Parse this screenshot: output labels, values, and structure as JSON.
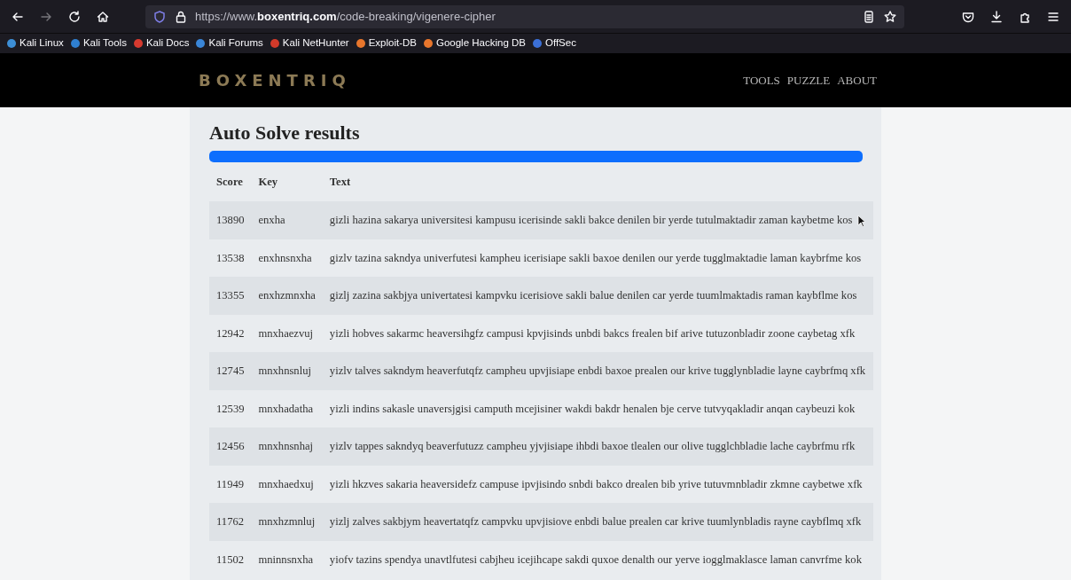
{
  "browser": {
    "url": "https://www.**boxentriq.com**/code-breaking/vigenere-cipher",
    "back_disabled": false,
    "forward_disabled": true
  },
  "bookmarks": [
    {
      "label": "Kali Linux",
      "color": "#3d8fd6"
    },
    {
      "label": "Kali Tools",
      "color": "#2f7fd0"
    },
    {
      "label": "Kali Docs",
      "color": "#d63a2f"
    },
    {
      "label": "Kali Forums",
      "color": "#3a86d8"
    },
    {
      "label": "Kali NetHunter",
      "color": "#d23a2a"
    },
    {
      "label": "Exploit-DB",
      "color": "#e8762c"
    },
    {
      "label": "Google Hacking DB",
      "color": "#e8762c"
    },
    {
      "label": "OffSec",
      "color": "#3b6fd6"
    }
  ],
  "site": {
    "logo": "BOXENTRIQ",
    "nav": [
      "TOOLS",
      "PUZZLE",
      "ABOUT"
    ]
  },
  "results": {
    "title": "Auto Solve results",
    "progress": {
      "level": 1
    },
    "columns": [
      "Score",
      "Key",
      "Text"
    ],
    "rows": [
      [
        "13890",
        "enxha",
        "gizli hazina sakarya universitesi kampusu icerisinde sakli bakce denilen bir yerde tutulmaktadir zaman kaybetme kos"
      ],
      [
        "13538",
        "enxhnsnxha",
        "gizlv tazina sakndya univerfutesi kampheu icerisiape sakli baxoe denilen our yerde tugglmaktadie laman kaybrfme kos"
      ],
      [
        "13355",
        "enxhzmnxha",
        "gizlj zazina sakbjya univertatesi kampvku icerisiove sakli balue denilen car yerde tuumlmaktadis raman kaybflme kos"
      ],
      [
        "12942",
        "mnxhaezvuj",
        "yizli hobves sakarmc heaversihgfz campusi kpvjisinds unbdi bakcs frealen bif arive tutuzonbladir zoone caybetag xfk"
      ],
      [
        "12745",
        "mnxhnsnluj",
        "yizlv talves sakndym heaverfutqfz campheu upvjisiape enbdi baxoe prealen our krive tugglynbladie layne caybrfmq xfk"
      ],
      [
        "12539",
        "mnxhadatha",
        "yizli indins sakasle unaversjgisi camputh mcejisiner wakdi bakdr henalen bje cerve tutvyqakladir anqan caybeuzi kok"
      ],
      [
        "12456",
        "mnxhnsnhaj",
        "yizlv tappes sakndyq beaverfutuzz campheu yjvjisiape ihbdi baxoe tlealen our olive tugglchbladie lache caybrfmu rfk"
      ],
      [
        "11949",
        "mnxhaedxuj",
        "yizli hkzves sakaria heaversidefz campuse ipvjisindo snbdi bakco drealen bib yrive tutuvmnbladir zkmne caybetwe xfk"
      ],
      [
        "11762",
        "mnxhzmnluj",
        "yizlj zalves sakbjym heavertatqfz campvku upvjisiove enbdi balue prealen car krive tuumlynbladis rayne caybflmq xfk"
      ],
      [
        "11502",
        "mninnsnxha",
        "yiofv tazins spendya unavtlfutesi cabjheu icejihcape sakdi quxoe denalth our yerve iogglmaklasce laman canvrfme kok"
      ]
    ]
  }
}
